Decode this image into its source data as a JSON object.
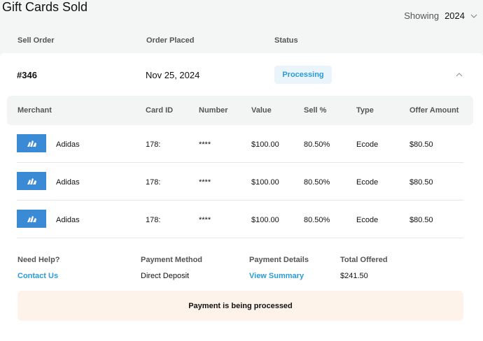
{
  "page": {
    "title": "Gift Cards Sold"
  },
  "filter": {
    "label": "Showing",
    "year": "2024"
  },
  "order_columns": {
    "sell_order": "Sell Order",
    "order_placed": "Order Placed",
    "status": "Status"
  },
  "order": {
    "id": "#346",
    "date": "Nov 25, 2024",
    "status": "Processing"
  },
  "table": {
    "headers": {
      "merchant": "Merchant",
      "card_id": "Card ID",
      "number": "Number",
      "value": "Value",
      "sell_pct": "Sell %",
      "type": "Type",
      "offer_amount": "Offer Amount"
    },
    "rows": [
      {
        "merchant": "Adidas",
        "card_id": "178:",
        "number": "****",
        "value": "$100.00",
        "sell_pct": "80.50%",
        "type": "Ecode",
        "offer": "$80.50"
      },
      {
        "merchant": "Adidas",
        "card_id": "178:",
        "number": "****",
        "value": "$100.00",
        "sell_pct": "80.50%",
        "type": "Ecode",
        "offer": "$80.50"
      },
      {
        "merchant": "Adidas",
        "card_id": "178:",
        "number": "****",
        "value": "$100.00",
        "sell_pct": "80.50%",
        "type": "Ecode",
        "offer": "$80.50"
      }
    ]
  },
  "footer": {
    "help_label": "Need Help?",
    "help_link": "Contact Us",
    "payment_method_label": "Payment Method",
    "payment_method": "Direct Deposit",
    "payment_details_label": "Payment Details",
    "payment_details_link": "View Summary",
    "total_label": "Total Offered",
    "total": "$241.50"
  },
  "banner": {
    "message": "Payment is being processed"
  },
  "colors": {
    "accent": "#2a9bd6",
    "logo_bg": "#3a8ad6",
    "banner_bg": "#fdf3ea",
    "pill_bg": "#eaf4fb"
  },
  "icons": {
    "year_toggle": "chevron-down-icon",
    "collapse": "chevron-up-icon",
    "merchant_logo": "adidas-logo-icon"
  }
}
